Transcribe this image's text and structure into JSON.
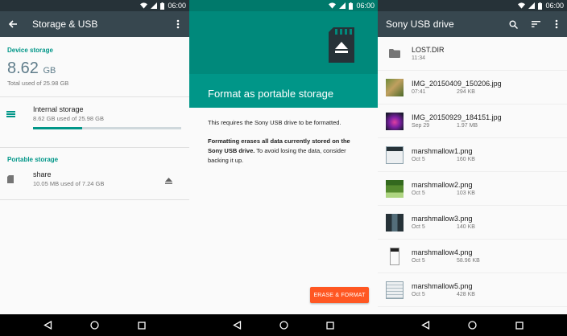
{
  "status_bar": {
    "time": "06:00"
  },
  "panel1": {
    "title": "Storage & USB",
    "device_section": "Device storage",
    "used_value": "8.62",
    "used_unit": "GB",
    "total_line": "Total used of 25.98 GB",
    "internal": {
      "label": "Internal storage",
      "detail": "8.62 GB used of 25.98 GB",
      "progress": 0.33
    },
    "portable_section": "Portable storage",
    "portable": {
      "label": "share",
      "detail": "10.05 MB used of 7.24 GB"
    }
  },
  "panel2": {
    "title": "Format as portable storage",
    "para1": "This requires the Sony USB drive to be formatted.",
    "para2_bold": "Formatting erases all data currently stored on the Sony USB drive.",
    "para2_rest": " To avoid losing the data, consider backing it up.",
    "button": "ERASE & FORMAT"
  },
  "panel3": {
    "title": "Sony USB drive",
    "files": [
      {
        "name": "LOST.DIR",
        "date": "11:34",
        "size": "",
        "thumb": "folder-icon"
      },
      {
        "name": "IMG_20150409_150206.jpg",
        "date": "07:41",
        "size": "294 KB",
        "thumb": "photo-thumbnail"
      },
      {
        "name": "IMG_20150929_184151.jpg",
        "date": "Sep 29",
        "size": "1.97 MB",
        "thumb": "photo-thumbnail"
      },
      {
        "name": "marshmallow1.png",
        "date": "Oct 5",
        "size": "160 KB",
        "thumb": "screenshot-thumbnail"
      },
      {
        "name": "marshmallow2.png",
        "date": "Oct 5",
        "size": "103 KB",
        "thumb": "screenshot-thumbnail"
      },
      {
        "name": "marshmallow3.png",
        "date": "Oct 5",
        "size": "140 KB",
        "thumb": "screenshot-thumbnail"
      },
      {
        "name": "marshmallow4.png",
        "date": "Oct 5",
        "size": "58.96 KB",
        "thumb": "screenshot-thumbnail"
      },
      {
        "name": "marshmallow5.png",
        "date": "Oct 5",
        "size": "428 KB",
        "thumb": "screenshot-thumbnail"
      }
    ]
  },
  "colors": {
    "accent": "#009688",
    "toolbar": "#37474f",
    "button": "#ff5722"
  }
}
